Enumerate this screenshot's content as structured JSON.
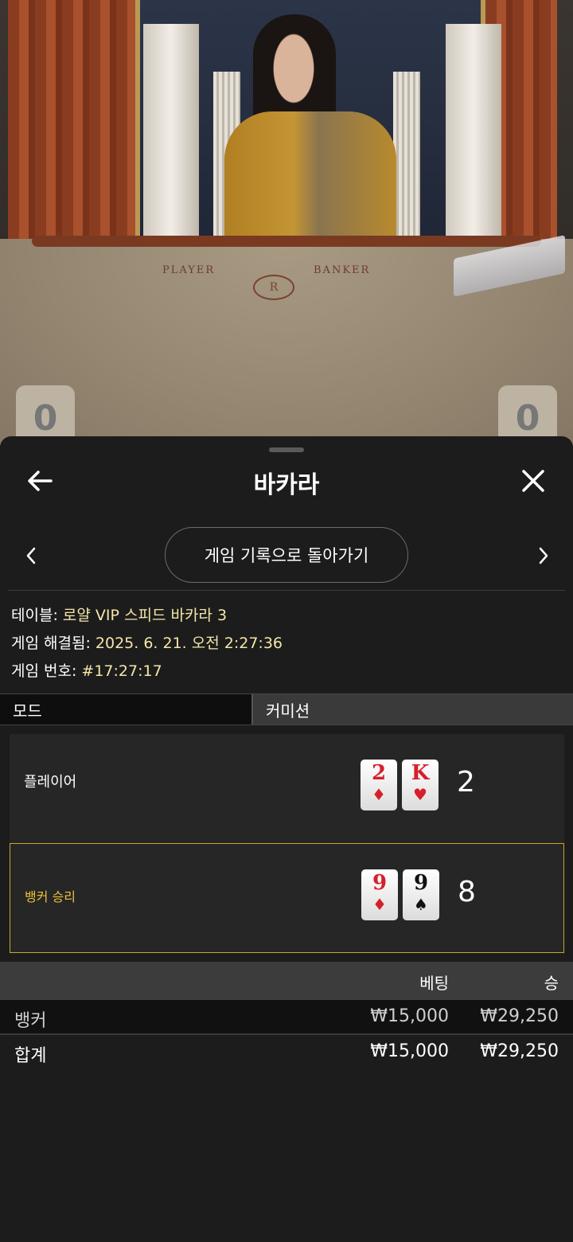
{
  "video": {
    "table_player_text": "PLAYER",
    "table_banker_text": "BANKER",
    "table_logo_text": "R",
    "player_score": "0",
    "banker_score": "0"
  },
  "header": {
    "title": "바카라",
    "back_icon": "arrow-left-icon",
    "close_icon": "close-icon"
  },
  "nav": {
    "history_button": "게임 기록으로 돌아가기",
    "prev_icon": "chevron-left-icon",
    "next_icon": "chevron-right-icon"
  },
  "info": {
    "table_label": "테이블:",
    "table_value": "로얄 VIP 스피드 바카라 3",
    "resolved_label": "게임 해결됨:",
    "resolved_value": "2025. 6. 21. 오전 2:27:36",
    "game_no_label": "게임 번호:",
    "game_no_value": "#17:27:17"
  },
  "tabs": {
    "mode": "모드",
    "commission": "커미션"
  },
  "hands": {
    "player": {
      "label": "플레이어",
      "cards": [
        {
          "rank": "2",
          "suit": "♦",
          "color": "red"
        },
        {
          "rank": "K",
          "suit": "♥",
          "color": "red"
        }
      ],
      "total": "2"
    },
    "banker": {
      "label": "뱅커 승리",
      "cards": [
        {
          "rank": "9",
          "suit": "♦",
          "color": "red"
        },
        {
          "rank": "9",
          "suit": "♠",
          "color": "black"
        }
      ],
      "total": "8"
    }
  },
  "summary": {
    "columns": {
      "bet": "베팅",
      "win": "승"
    },
    "rows": [
      {
        "name": "뱅커",
        "bet": "₩15,000",
        "win": "₩29,250"
      }
    ],
    "total": {
      "name": "합계",
      "bet": "₩15,000",
      "win": "₩29,250"
    }
  },
  "colors": {
    "accent": "#e8c33b",
    "info_value": "#f4e6a8",
    "sheet_bg": "#1c1c1c"
  }
}
